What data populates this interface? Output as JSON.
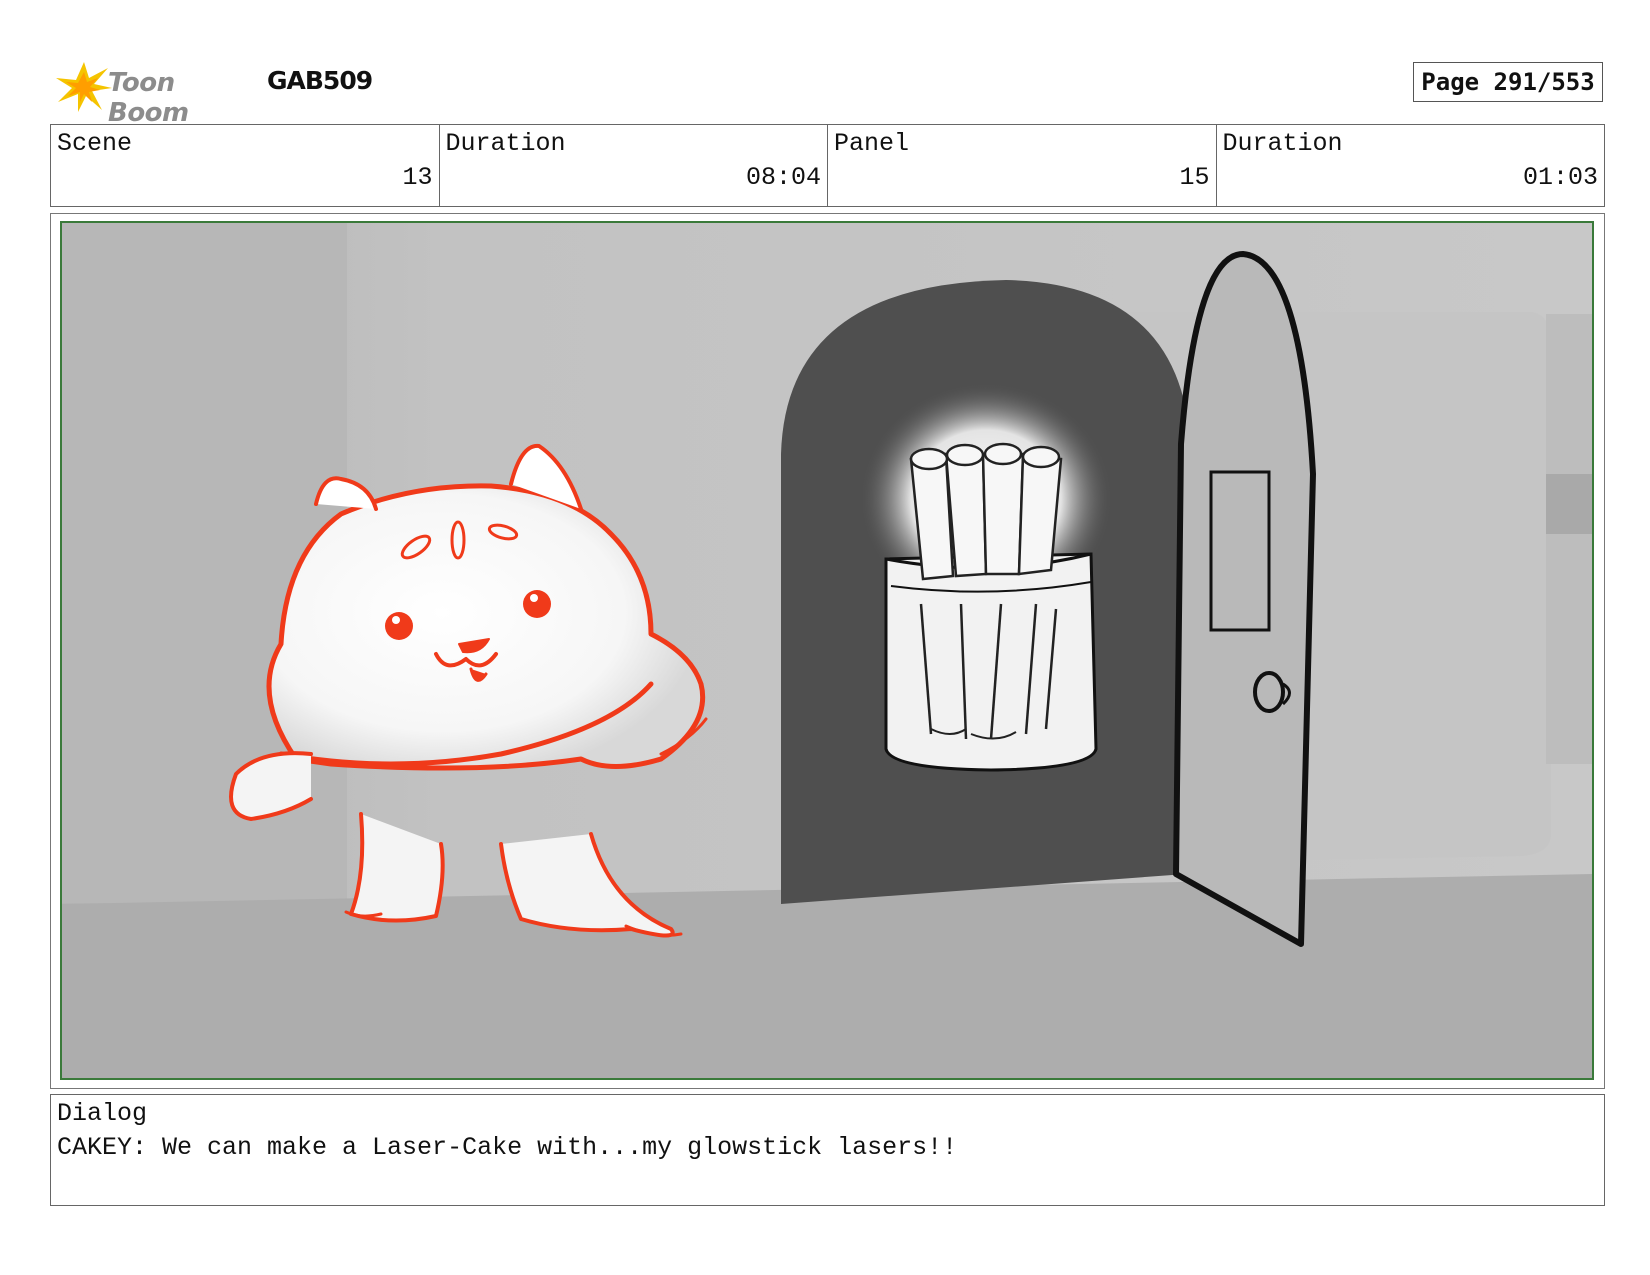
{
  "header": {
    "logo_text": "Toon Boom",
    "project_code": "GAB509",
    "page_label": "Page 291/553"
  },
  "info": [
    {
      "label": "Scene",
      "value": "13"
    },
    {
      "label": "Duration",
      "value": "08:04"
    },
    {
      "label": "Panel",
      "value": "15"
    },
    {
      "label": "Duration",
      "value": "01:03"
    }
  ],
  "dialog": {
    "label": "Dialog",
    "text": "CAKEY: We can make a Laser-Cake with...my glowstick lasers!!"
  },
  "colors": {
    "sketch_red": "#f03a1a",
    "frame_green": "#3a7a3a",
    "logo_yellow": "#f5c400"
  }
}
